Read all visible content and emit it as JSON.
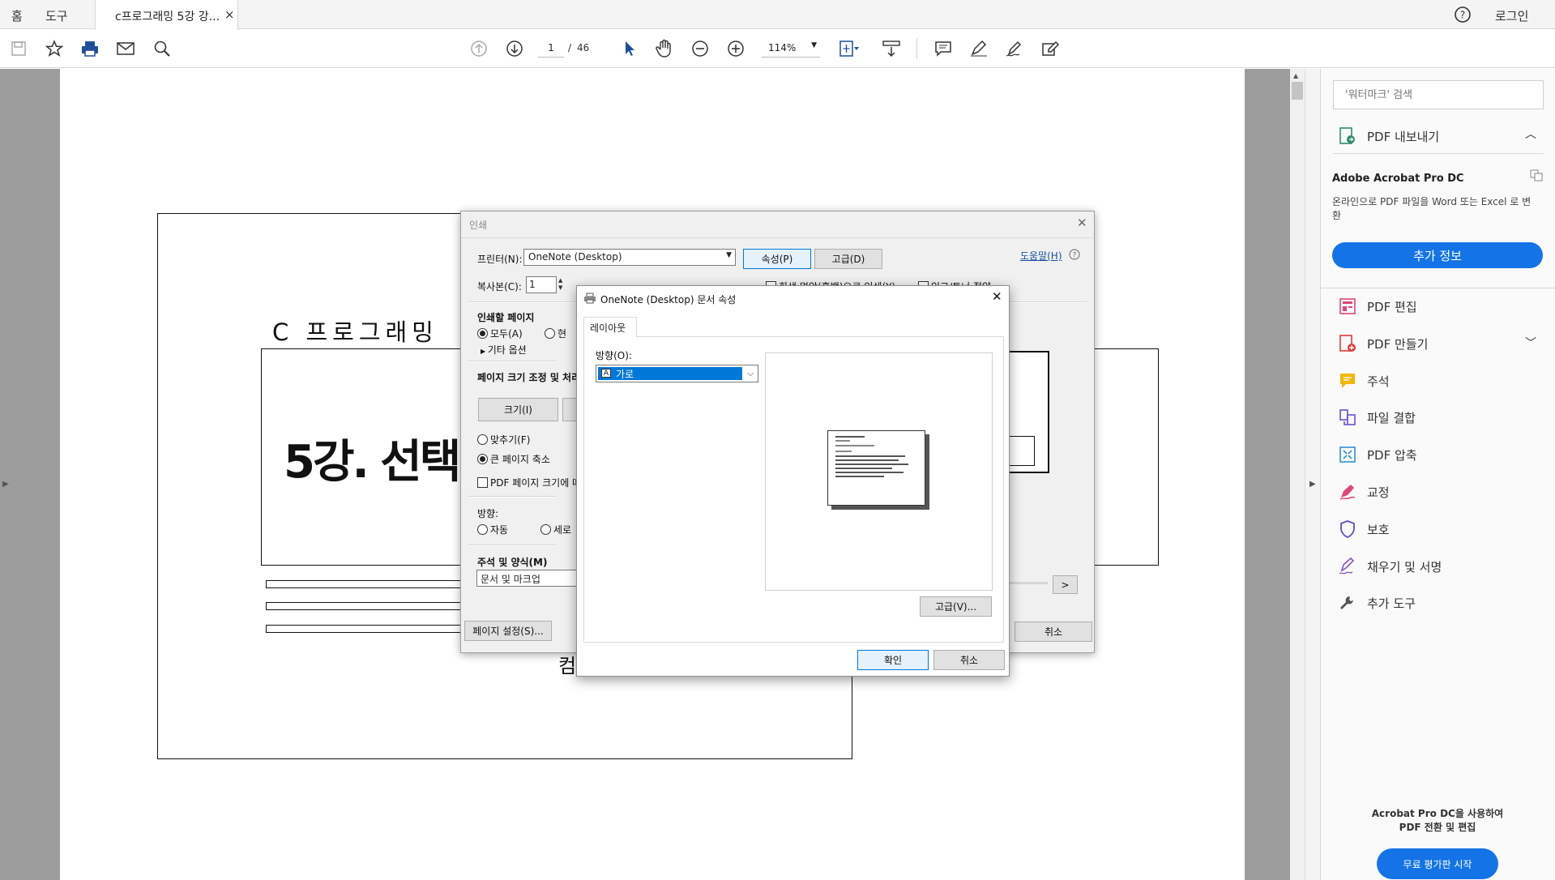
{
  "menu": {
    "home": "홈",
    "tools": "도구",
    "login": "로그인",
    "help_icon": "help-circle-icon"
  },
  "tab": {
    "title": "c프로그래밍 5강 강...",
    "close": "×"
  },
  "toolbar": {
    "page_current": "1",
    "page_sep": "/",
    "page_total": "46",
    "zoom": "114%"
  },
  "document": {
    "heading": "C 프로그래밍",
    "lecture_title": "5강. 선택",
    "footer_text": "컴"
  },
  "panel": {
    "search_placeholder": "'워터마크' 검색",
    "export_label": "PDF 내보내기",
    "product_name": "Adobe Acrobat Pro DC",
    "product_desc": "온라인으로 PDF 파일을 Word 또는 Excel 로 변환",
    "more_info_button": "추가 정보",
    "tools": [
      {
        "label": "PDF 편집",
        "color": "#e0457b"
      },
      {
        "label": "PDF 만들기",
        "color": "#e03a3a"
      },
      {
        "label": "주석",
        "color": "#f2b705"
      },
      {
        "label": "파일 결합",
        "color": "#6b4fd8"
      },
      {
        "label": "PDF 압축",
        "color": "#2f8fd8"
      },
      {
        "label": "교정",
        "color": "#e0457b"
      },
      {
        "label": "보호",
        "color": "#5b4fd8"
      },
      {
        "label": "채우기 및 서명",
        "color": "#8a55c9"
      },
      {
        "label": "추가 도구",
        "color": "#555555"
      }
    ],
    "promo_text_1": "Acrobat Pro DC을 사용하여",
    "promo_text_2": "PDF 전환 및 편집",
    "trial_button": "무료 평가판 시작",
    "accent": "#1473e6"
  },
  "print_dialog": {
    "title": "인쇄",
    "printer_label": "프린터(N):",
    "printer_value": "OneNote (Desktop)",
    "properties_button": "속성(P)",
    "advanced_button": "고급(D)",
    "help_link": "도움말(H)",
    "copies_label": "복사본(C):",
    "copies_value": "1",
    "grayscale_label": "회색 명암(흑백)으로 인쇄(Y)",
    "ink_label": "잉크/토너 절약",
    "pages_section": "인쇄할 페이지",
    "all_option": "모두(A)",
    "current_option": "현",
    "more_options": "기타 옵션",
    "size_section": "페이지 크기 조정 및 처리",
    "size_button": "크기(I)",
    "fit_option": "맞추기(F)",
    "shrink_option": "큰 페이지 축소",
    "pdf_size_option": "PDF 페이지 크기에 따",
    "orientation_section": "방향:",
    "auto_option": "자동",
    "portrait_option": "세로",
    "comments_section": "주석 및 양식(M)",
    "comments_value": "문서 및 마크업",
    "page_setup_button": "페이지 설정(S)...",
    "cancel_button": "취소",
    "next_button": ">"
  },
  "prop_dialog": {
    "title": "OneNote (Desktop) 문서 속성",
    "tab_layout": "레이아웃",
    "orientation_label": "방향(O):",
    "orientation_value": "가로",
    "advanced_button": "고급(V)...",
    "ok_button": "확인",
    "cancel_button": "취소"
  }
}
